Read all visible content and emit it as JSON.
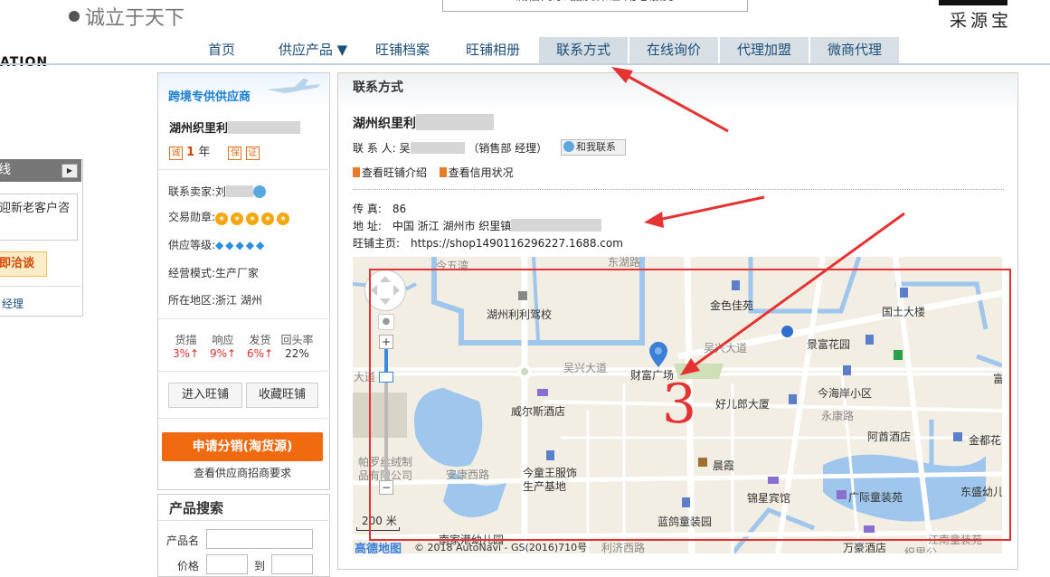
{
  "header": {
    "slogan": "诚立于天下",
    "tagline": "诚信商家 品质保证 用心服务",
    "brand": "采源宝",
    "partial_logo": "ATION"
  },
  "nav": {
    "items": [
      "首页",
      "供应产品 ▼",
      "旺铺档案",
      "旺铺相册",
      "联系方式",
      "在线询价",
      "代理加盟",
      "微商代理"
    ],
    "active": "联系方式"
  },
  "edge_widget": {
    "title": "线",
    "bubble": "迎新老客户咨",
    "button": "即洽谈",
    "link": "经理"
  },
  "sidebar": {
    "banner": "跨境专供供应商",
    "company_short": "湖州织里利",
    "years": "1",
    "years_unit": "年",
    "contact_label": "联系卖家:",
    "contact_value": "刘",
    "medal_label": "交易勋章:",
    "level_label": "供应等级:",
    "mode_label": "经营模式:",
    "mode_value": "生产厂家",
    "region_label": "所在地区:",
    "region_value": "浙江 湖州",
    "stats": [
      {
        "label": "货描",
        "value": "3%↑"
      },
      {
        "label": "响应",
        "value": "9%↑"
      },
      {
        "label": "发货",
        "value": "6%↑"
      },
      {
        "label": "回头率",
        "value": "22%"
      }
    ],
    "enter_shop": "进入旺铺",
    "fav_shop": "收藏旺铺",
    "distribution_btn": "申请分销(淘货源)",
    "distribution_link": "查看供应商招商要求",
    "search_title": "产品搜索",
    "product_name_label": "产品名",
    "price_label": "价格",
    "price_to": "到"
  },
  "main": {
    "title": "联系方式",
    "company_name": "湖州织里利",
    "contact_label": "联 系 人:",
    "contact_name": "吴",
    "contact_role": "（销售部 经理）",
    "chat_btn": "和我联系",
    "link_shop_intro": "查看旺铺介绍",
    "link_credit": "查看信用状况",
    "fax_label": "传    真:",
    "fax_value": "86",
    "addr_label": "地    址:",
    "addr_value": "中国 浙江 湖州市 织里镇",
    "home_label": "旺铺主页:",
    "home_value": "https://shop1490116296227.1688.com"
  },
  "map": {
    "labels": [
      "今五湾",
      "东湖路",
      "湖州利利驾校",
      "金色佳苑",
      "国土大楼",
      "景富花园",
      "吴兴大道",
      "吴兴大道",
      "财富广场",
      "大道",
      "好儿郎大厦",
      "今海岸小区",
      "富",
      "威尔斯酒店",
      "永康路",
      "阿酋酒店",
      "金都花",
      "帕罗丝绒制品有限公司",
      "今童王服饰生产基地",
      "晨霞",
      "安康西路",
      "锦星宾馆",
      "广际童装苑",
      "东盛幼儿",
      "蓝鸽童装园",
      "南家港幼儿园",
      "利济西路",
      "万豪酒店",
      "江南童装苑",
      "织里公"
    ],
    "scale": "200 米",
    "attribution": "© 2018 AutoNavi - GS(2016)710号",
    "logo": "高德地图",
    "annotation": "3"
  },
  "colors": {
    "nav_text": "#1d4f78",
    "accent_orange": "#f26a10",
    "annotation_red": "#e53232",
    "stat_red": "#d43030"
  }
}
